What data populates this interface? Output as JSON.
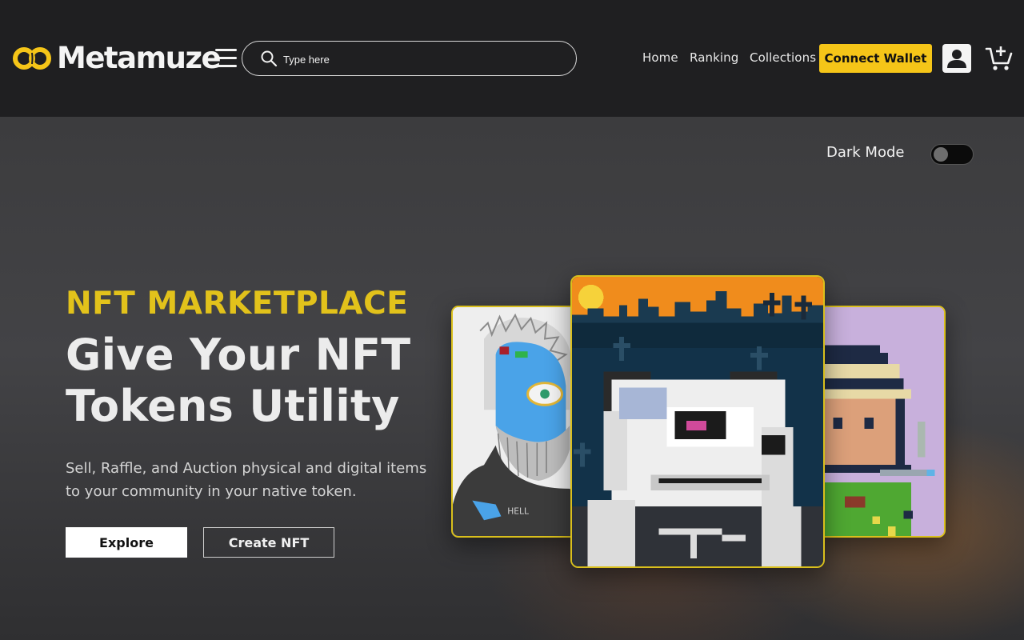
{
  "brand": {
    "name": "Metamuze",
    "accent": "#f5c518"
  },
  "header": {
    "search_placeholder": "Type here",
    "nav": [
      "Home",
      "Ranking",
      "Collections"
    ],
    "connect_label": "Connect Wallet",
    "icons": [
      "menu-icon",
      "search-icon",
      "user-icon",
      "cart-add-icon"
    ]
  },
  "hero": {
    "dark_mode_label": "Dark Mode",
    "dark_mode_on": false,
    "kicker": "NFT MARKETPLACE",
    "headline": "Give Your NFT Tokens Utility",
    "subtext": "Sell, Raffle, and Auction physical and digital items to your community in your native token.",
    "explore_label": "Explore",
    "create_label": "Create NFT"
  },
  "colors": {
    "kicker": "#e2c21b",
    "card_border": "#d9bf1c",
    "header_bg": "#1f1f21"
  }
}
